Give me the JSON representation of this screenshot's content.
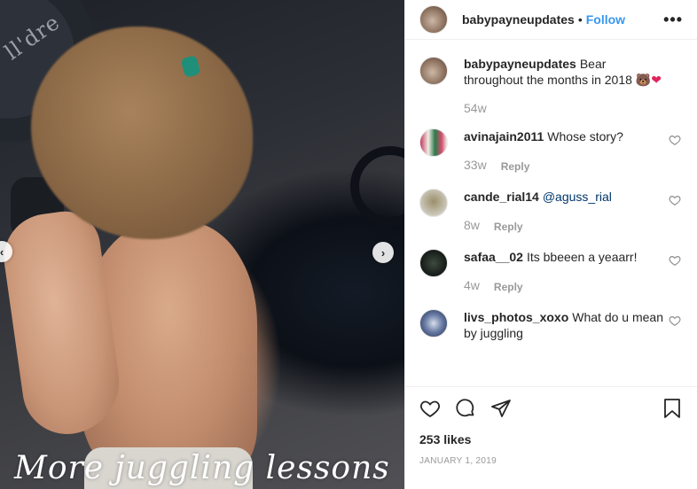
{
  "post": {
    "username": "babypayneupdates",
    "dot": "•",
    "follow_label": "Follow",
    "more_label": "•••",
    "photo_caption": "More juggling lessons",
    "caption": {
      "username": "babypayneupdates",
      "text": "Bear throughout the months in 2018",
      "emoji_bear": "🐻",
      "emoji_heart": "❤",
      "time": "54w"
    },
    "comments": [
      {
        "username": "avinajain2011",
        "text": "Whose story?",
        "mention": "",
        "time": "33w",
        "reply": "Reply"
      },
      {
        "username": "cande_rial14",
        "text": "",
        "mention": "@aguss_rial",
        "time": "8w",
        "reply": "Reply"
      },
      {
        "username": "safaa__02",
        "text": "Its bbeeen a yeaarr!",
        "mention": "",
        "time": "4w",
        "reply": "Reply"
      },
      {
        "username": "livs_photos_xoxo",
        "text": "What do u mean by juggling",
        "mention": "",
        "time": "",
        "reply": ""
      }
    ],
    "likes": "253 likes",
    "date": "JANUARY 1, 2019"
  },
  "icons": {
    "like": "heart-icon",
    "comment": "comment-bubble-icon",
    "share": "paper-plane-icon",
    "save": "bookmark-icon",
    "comment_like": "small-heart-icon",
    "prev": "chevron-left-icon",
    "next": "chevron-right-icon"
  },
  "colors": {
    "link": "#3897f0",
    "mention": "#003569",
    "muted": "#999999",
    "border": "#efefef"
  }
}
